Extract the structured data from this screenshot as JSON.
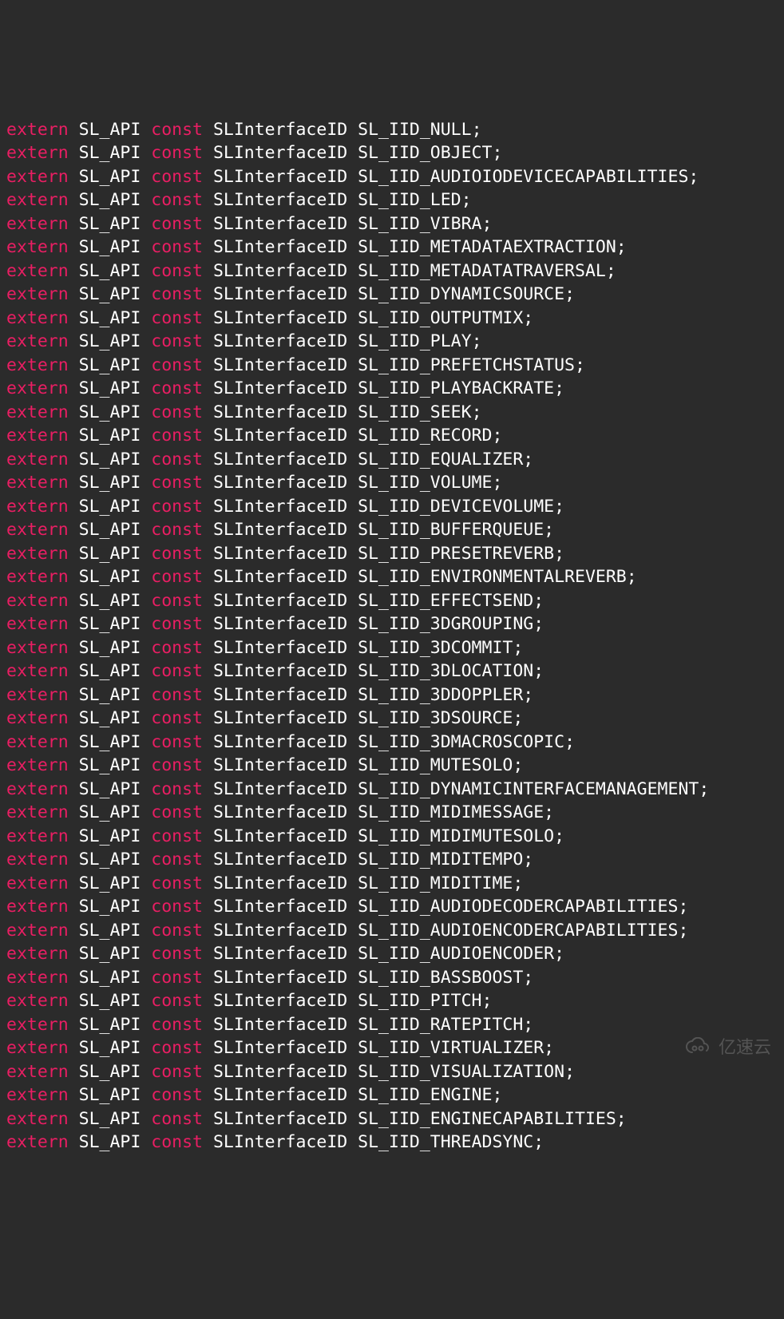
{
  "keyword_extern": "extern",
  "keyword_const": "const",
  "api_token": "SL_API",
  "type_token": "SLInterfaceID",
  "semicolon": ";",
  "declarations": [
    "SL_IID_NULL",
    "SL_IID_OBJECT",
    "SL_IID_AUDIOIODEVICECAPABILITIES",
    "SL_IID_LED",
    "SL_IID_VIBRA",
    "SL_IID_METADATAEXTRACTION",
    "SL_IID_METADATATRAVERSAL",
    "SL_IID_DYNAMICSOURCE",
    "SL_IID_OUTPUTMIX",
    "SL_IID_PLAY",
    "SL_IID_PREFETCHSTATUS",
    "SL_IID_PLAYBACKRATE",
    "SL_IID_SEEK",
    "SL_IID_RECORD",
    "SL_IID_EQUALIZER",
    "SL_IID_VOLUME",
    "SL_IID_DEVICEVOLUME",
    "SL_IID_BUFFERQUEUE",
    "SL_IID_PRESETREVERB",
    "SL_IID_ENVIRONMENTALREVERB",
    "SL_IID_EFFECTSEND",
    "SL_IID_3DGROUPING",
    "SL_IID_3DCOMMIT",
    "SL_IID_3DLOCATION",
    "SL_IID_3DDOPPLER",
    "SL_IID_3DSOURCE",
    "SL_IID_3DMACROSCOPIC",
    "SL_IID_MUTESOLO",
    "SL_IID_DYNAMICINTERFACEMANAGEMENT",
    "SL_IID_MIDIMESSAGE",
    "SL_IID_MIDIMUTESOLO",
    "SL_IID_MIDITEMPO",
    "SL_IID_MIDITIME",
    "SL_IID_AUDIODECODERCAPABILITIES",
    "SL_IID_AUDIOENCODERCAPABILITIES",
    "SL_IID_AUDIOENCODER",
    "SL_IID_BASSBOOST",
    "SL_IID_PITCH",
    "SL_IID_RATEPITCH",
    "SL_IID_VIRTUALIZER",
    "SL_IID_VISUALIZATION",
    "SL_IID_ENGINE",
    "SL_IID_ENGINECAPABILITIES",
    "SL_IID_THREADSYNC"
  ],
  "watermark_text": "亿速云"
}
